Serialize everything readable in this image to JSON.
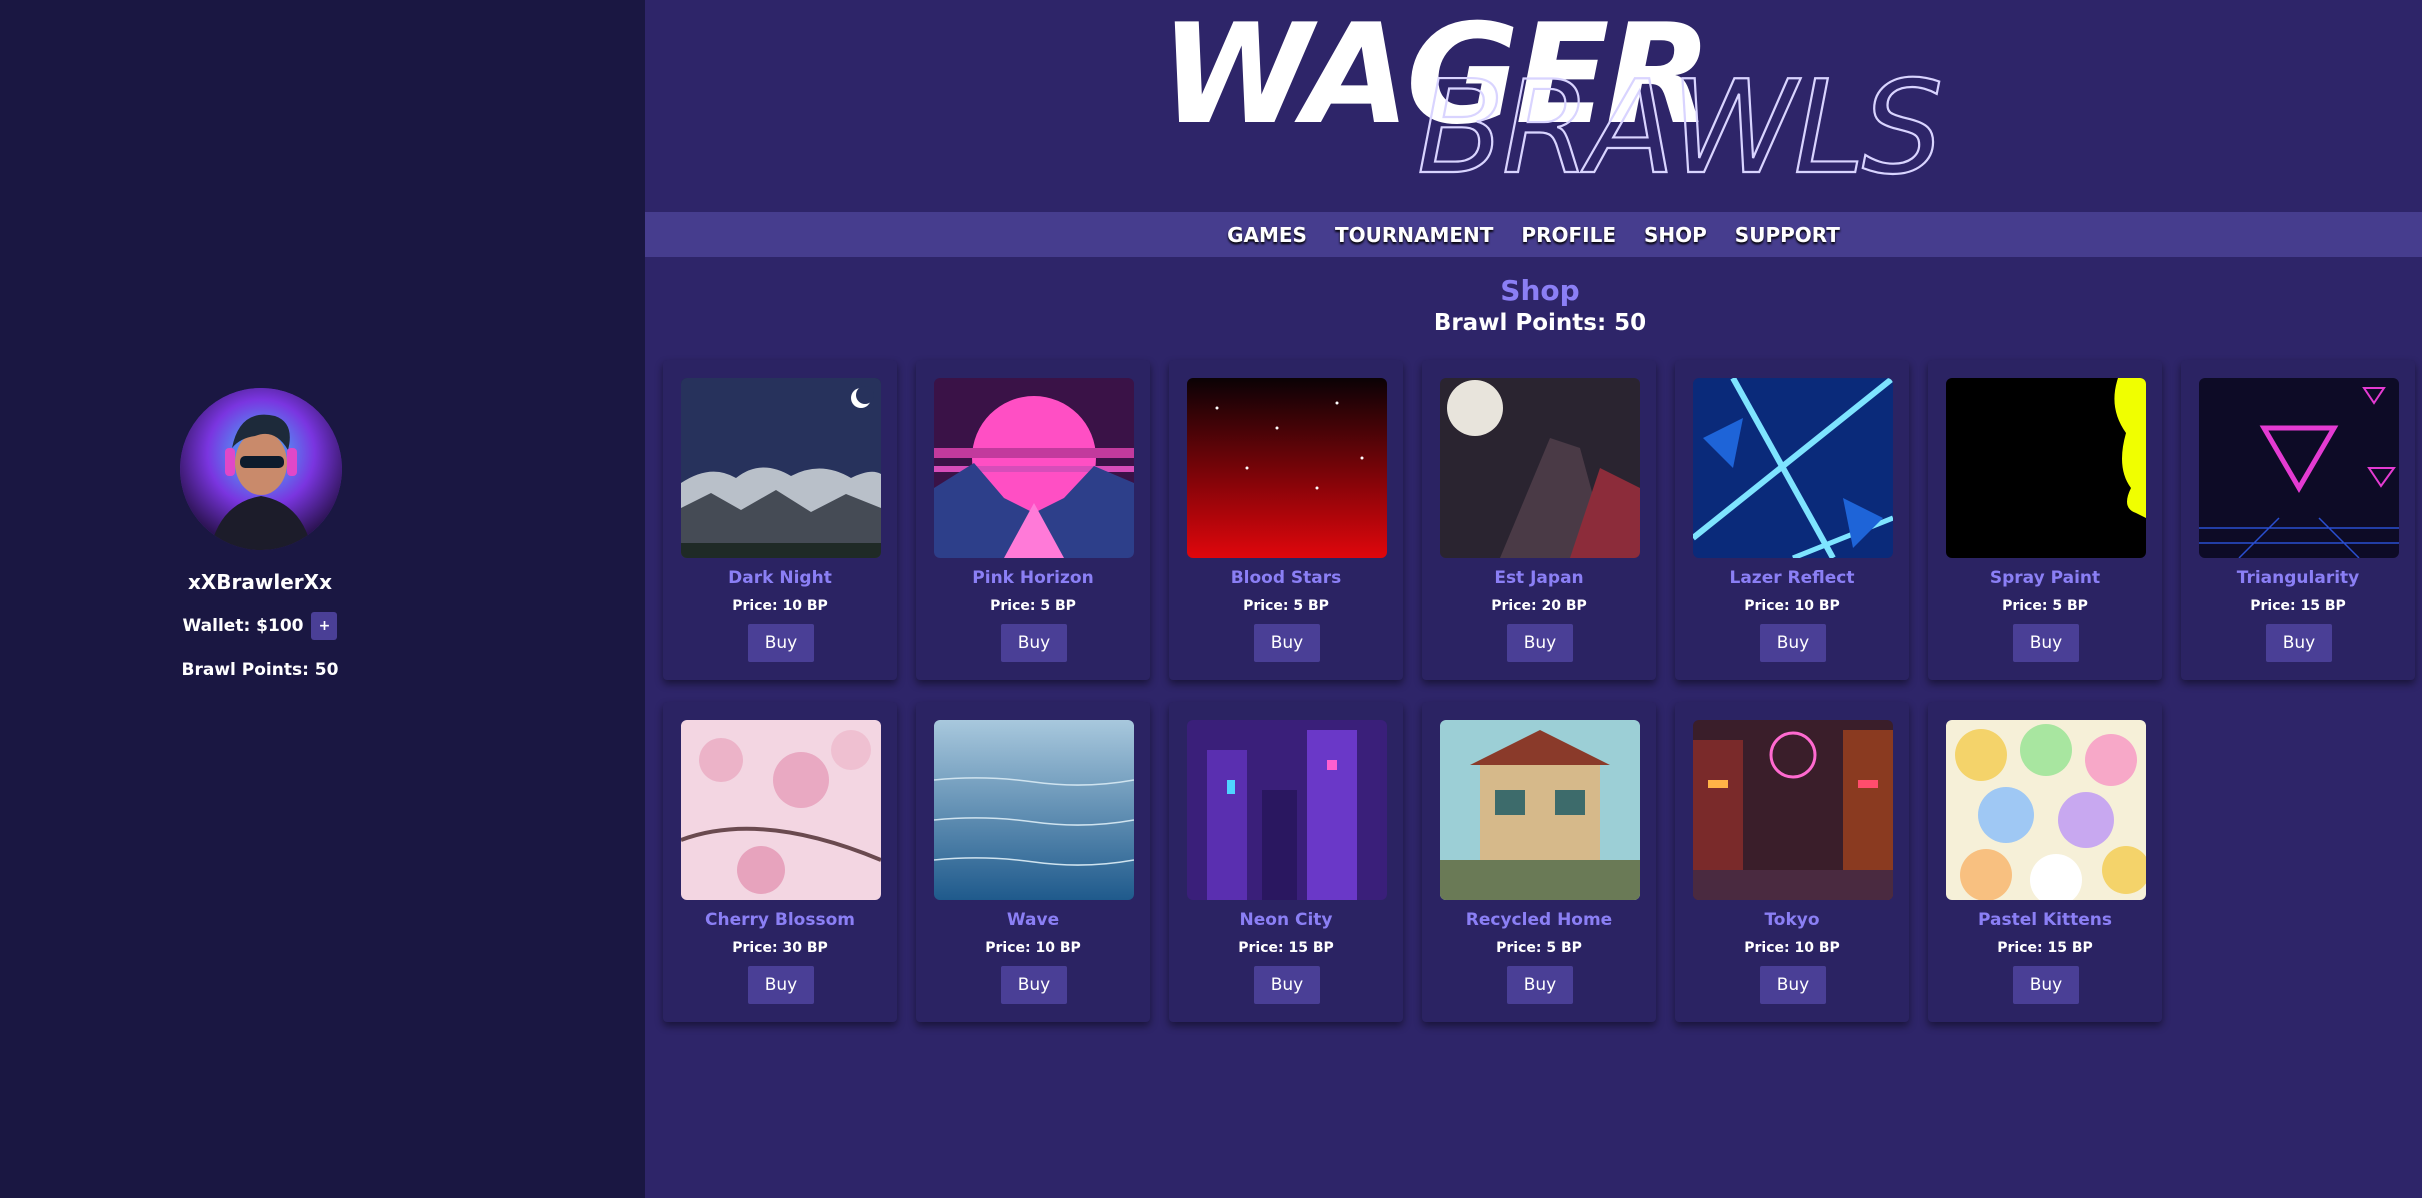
{
  "sidebar": {
    "username": "xXBrawlerXx",
    "wallet_label": "Wallet: $100",
    "wallet_add": "+",
    "points_label": "Brawl Points: 50"
  },
  "header": {
    "logo_top": "WAGER",
    "logo_bottom": "BRAWLS"
  },
  "nav": {
    "items": [
      "GAMES",
      "TOURNAMENT",
      "PROFILE",
      "SHOP",
      "SUPPORT"
    ]
  },
  "shop": {
    "title": "Shop",
    "points_label": "Brawl Points: 50",
    "buy_label": "Buy",
    "items": [
      {
        "name": "Dark Night",
        "price": "Price: 10 BP"
      },
      {
        "name": "Pink Horizon",
        "price": "Price: 5 BP"
      },
      {
        "name": "Blood Stars",
        "price": "Price: 5 BP"
      },
      {
        "name": "Est Japan",
        "price": "Price: 20 BP"
      },
      {
        "name": "Lazer Reflect",
        "price": "Price: 10 BP"
      },
      {
        "name": "Spray Paint",
        "price": "Price: 5 BP"
      },
      {
        "name": "Triangularity",
        "price": "Price: 15 BP"
      },
      {
        "name": "Cherry Blossom",
        "price": "Price: 30 BP"
      },
      {
        "name": "Wave",
        "price": "Price: 10 BP"
      },
      {
        "name": "Neon City",
        "price": "Price: 15 BP"
      },
      {
        "name": "Recycled Home",
        "price": "Price: 5 BP"
      },
      {
        "name": "Tokyo",
        "price": "Price: 10 BP"
      },
      {
        "name": "Pastel Kittens",
        "price": "Price: 15 BP"
      }
    ]
  }
}
